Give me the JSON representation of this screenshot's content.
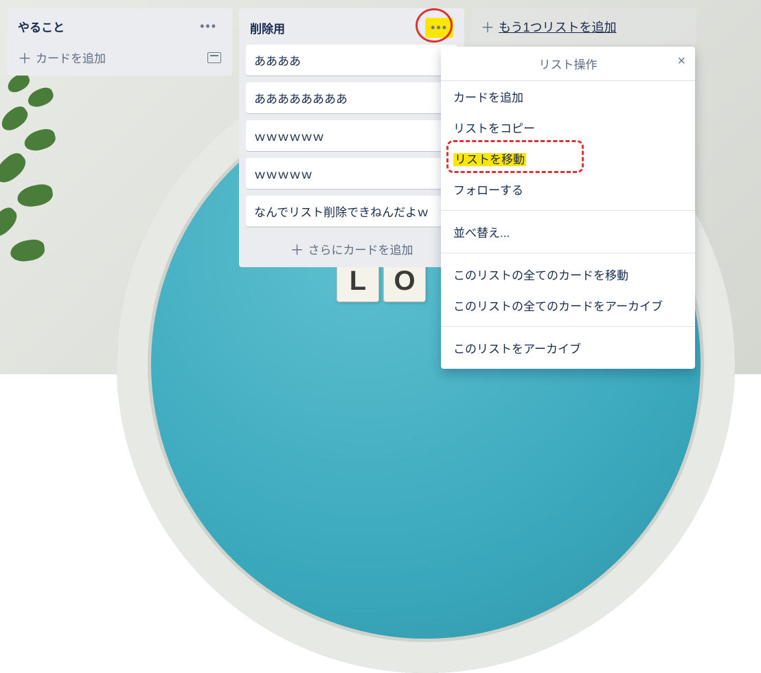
{
  "lists": [
    {
      "title": "やること",
      "add_label": "カードを追加",
      "cards": []
    },
    {
      "title": "削除用",
      "add_label": "さらにカードを追加",
      "cards": [
        "ああああ",
        "ああああああああ",
        "ｗｗｗｗｗｗ",
        "ｗｗｗｗｗ",
        "なんでリスト削除できねんだよｗ"
      ]
    }
  ],
  "add_list_label": "もう1つリストを追加",
  "popover": {
    "title": "リスト操作",
    "items_group1": [
      "カードを追加",
      "リストをコピー",
      "リストを移動",
      "フォローする"
    ],
    "items_group2": [
      "並べ替え..."
    ],
    "items_group3": [
      "このリストの全てのカードを移動",
      "このリストの全てのカードをアーカイブ"
    ],
    "items_group4": [
      "このリストをアーカイブ"
    ]
  },
  "bg_tiles": [
    "L",
    "O"
  ]
}
